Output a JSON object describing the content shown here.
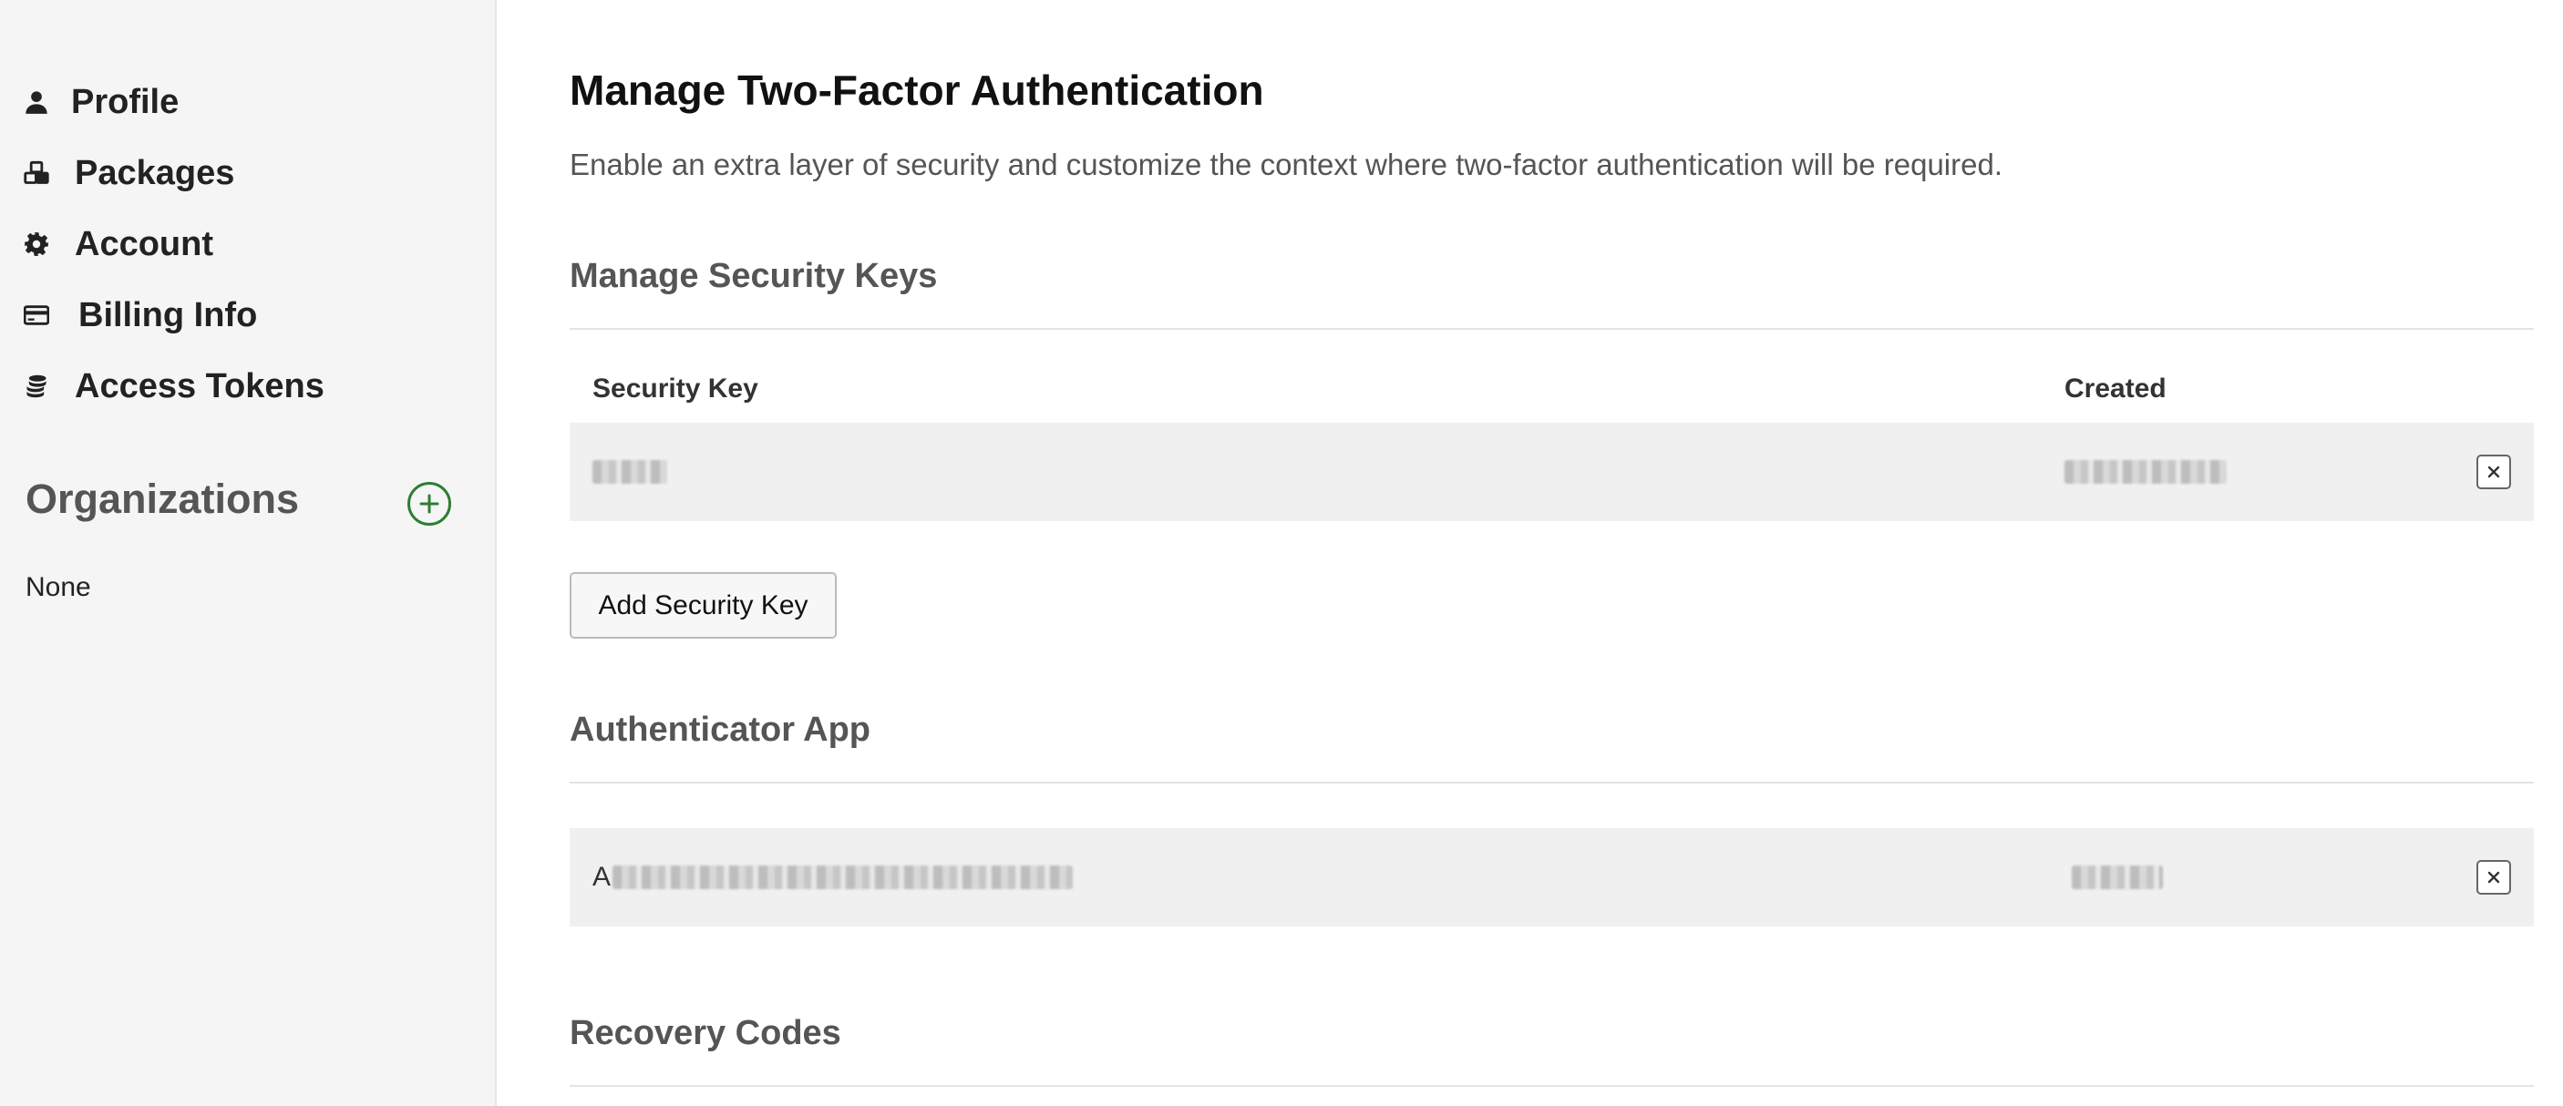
{
  "sidebar": {
    "items": [
      {
        "label": "Profile",
        "icon": "user-icon"
      },
      {
        "label": "Packages",
        "icon": "packages-icon"
      },
      {
        "label": "Account",
        "icon": "gear-icon"
      },
      {
        "label": "Billing Info",
        "icon": "credit-card-icon"
      },
      {
        "label": "Access Tokens",
        "icon": "coins-icon"
      }
    ],
    "organizations": {
      "title": "Organizations",
      "add_icon": "plus-circle-icon",
      "empty_text": "None"
    }
  },
  "main": {
    "title": "Manage Two-Factor Authentication",
    "description": "Enable an extra layer of security and customize the context where two-factor authentication will be required.",
    "security_keys": {
      "title": "Manage Security Keys",
      "columns": [
        "Security Key",
        "Created"
      ],
      "rows": [
        {
          "key_name": "[redacted]",
          "created": "[redacted]"
        }
      ],
      "add_button_label": "Add Security Key"
    },
    "authenticator_app": {
      "title": "Authenticator App",
      "rows": [
        {
          "name_visible_prefix": "A",
          "name": "[redacted]",
          "created": "[redacted]"
        }
      ]
    },
    "recovery_codes": {
      "title": "Recovery Codes"
    }
  },
  "colors": {
    "sidebar_bg": "#f5f5f5",
    "accent_green": "#2e7d32",
    "row_bg": "#f0f0f0",
    "muted_text": "#555555"
  }
}
